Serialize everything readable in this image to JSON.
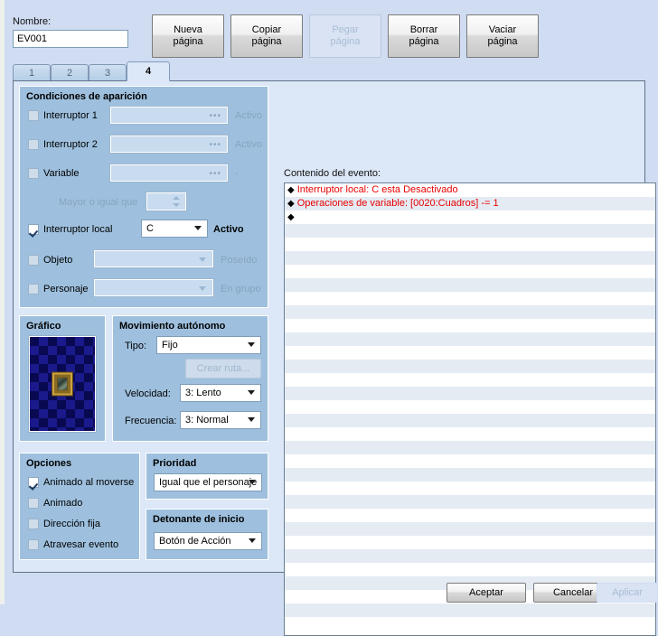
{
  "header": {
    "name_label": "Nombre:",
    "name_value": "EV001",
    "buttons": [
      {
        "label": "Nueva\npágina",
        "line1": "Nueva",
        "line2": "página",
        "enabled": true
      },
      {
        "label": "Copiar página",
        "line1": "Copiar",
        "line2": "página",
        "enabled": true
      },
      {
        "label": "Pegar página",
        "line1": "Pegar",
        "line2": "página",
        "enabled": false
      },
      {
        "label": "Borrar página",
        "line1": "Borrar",
        "line2": "página",
        "enabled": true
      },
      {
        "label": "Vaciar página",
        "line1": "Vaciar",
        "line2": "página",
        "enabled": true
      }
    ]
  },
  "tabs": [
    {
      "label": "1",
      "active": false
    },
    {
      "label": "2",
      "active": false
    },
    {
      "label": "3",
      "active": false
    },
    {
      "label": "4",
      "active": true
    }
  ],
  "conditions": {
    "title": "Condiciones de aparición",
    "switch1": {
      "label": "Interruptor 1",
      "checked": false,
      "value": "",
      "suffix": "Activo"
    },
    "switch2": {
      "label": "Interruptor 2",
      "checked": false,
      "value": "",
      "suffix": "Activo"
    },
    "variable": {
      "label": "Variable",
      "checked": false,
      "value": "",
      "suffix": "-"
    },
    "greater_equal": {
      "label": "Mayor o igual que",
      "value": ""
    },
    "local_switch": {
      "label": "Interruptor local",
      "checked": true,
      "value": "C",
      "suffix": "Activo"
    },
    "item": {
      "label": "Objeto",
      "checked": false,
      "value": "",
      "suffix": "Poseído"
    },
    "actor": {
      "label": "Personaje",
      "checked": false,
      "value": "",
      "suffix": "En grupo"
    }
  },
  "graphic": {
    "title": "Gráfico"
  },
  "movement": {
    "title": "Movimiento autónomo",
    "type_label": "Tipo:",
    "type_value": "Fijo",
    "route_button": "Crear ruta...",
    "speed_label": "Velocidad:",
    "speed_value": "3: Lento",
    "freq_label": "Frecuencia:",
    "freq_value": "3: Normal"
  },
  "options": {
    "title": "Opciones",
    "items": [
      {
        "label": "Animado al moverse",
        "checked": true
      },
      {
        "label": "Animado",
        "checked": false
      },
      {
        "label": "Dirección fija",
        "checked": false
      },
      {
        "label": "Atravesar evento",
        "checked": false
      }
    ]
  },
  "priority": {
    "title": "Prioridad",
    "value": "Igual que el personaje"
  },
  "trigger": {
    "title": "Detonante de inicio",
    "value": "Botón de Acción"
  },
  "event_content": {
    "label": "Contenido del evento:",
    "rows": [
      {
        "bullet": "◆",
        "text": "Interruptor local: C esta Desactivado"
      },
      {
        "bullet": "◆",
        "text": "Operaciones de variable: [0020:Cuadros] -= 1"
      },
      {
        "bullet": "◆",
        "text": ""
      }
    ],
    "total_rows": 33
  },
  "footer": {
    "accept": "Aceptar",
    "cancel": "Cancelar",
    "apply": "Aplicar",
    "apply_enabled": false
  },
  "colors": {
    "window_bg": "#cfdcf2",
    "panel_bg": "#9ec0de",
    "content_bg": "#dce7f7",
    "event_text": "#e80000",
    "alt_row": "#e4ebf3"
  }
}
